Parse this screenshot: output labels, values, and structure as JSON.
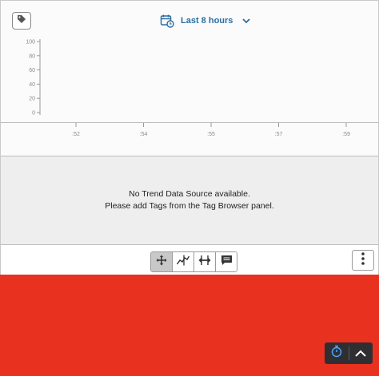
{
  "header": {
    "time_range_label": "Last 8 hours",
    "tag_icon": "tag-icon",
    "calendar_icon": "calendar-clock-icon",
    "dropdown_icon": "chevron-down-icon"
  },
  "chart_data": {
    "type": "line",
    "title": "",
    "xlabel": "",
    "ylabel": "",
    "ylim": [
      0,
      100
    ],
    "y_ticks": [
      "100",
      "80",
      "60",
      "40",
      "20",
      "0"
    ],
    "x_ticks": [
      ":52",
      ":54",
      ":55",
      ":57",
      ":59"
    ],
    "series": []
  },
  "empty_state": {
    "line1": "No Trend Data Source available.",
    "line2": "Please add Tags from the Tag Browser panel."
  },
  "toolbar": {
    "tools": [
      {
        "name": "pan",
        "icon": "move-arrows-icon",
        "active": true
      },
      {
        "name": "trend-cursor",
        "icon": "cursor-line-icon",
        "active": false
      },
      {
        "name": "zoom-range",
        "icon": "horizontal-resize-icon",
        "active": false
      },
      {
        "name": "annotation",
        "icon": "comment-icon",
        "active": false
      }
    ],
    "more_icon": "vertical-ellipsis-icon"
  },
  "colors": {
    "accent": "#2c6ea1",
    "red_panel": "#e8321f",
    "floating_control_bg": "#2f2f33"
  },
  "floating_controls": {
    "timer_icon": "stopwatch-icon",
    "collapse_icon": "chevron-up-icon"
  }
}
